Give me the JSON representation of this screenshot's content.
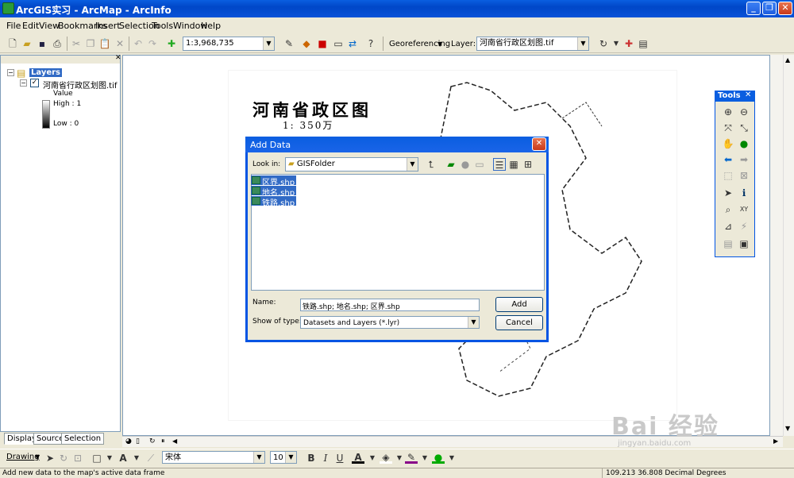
{
  "window": {
    "title": "ArcGIS实习 - ArcMap - ArcInfo",
    "minimize_glyph": "_",
    "maximize_glyph": "❐",
    "close_glyph": "✕"
  },
  "menu": [
    "File",
    "Edit",
    "View",
    "Bookmarks",
    "Insert",
    "Selection",
    "Tools",
    "Window",
    "Help"
  ],
  "standard_toolbar": {
    "scale": "1:3,968,735"
  },
  "georef_toolbar": {
    "georeferencing_label": "Georeferencing",
    "layer_label": "Layer:",
    "layer_value": "河南省行政区划图.tif"
  },
  "toc": {
    "root": "Layers",
    "layer_name": "河南省行政区划图.tif",
    "value_label": "Value",
    "high": "High : 1",
    "low": "Low : 0",
    "tabs": [
      "Display",
      "Source",
      "Selection"
    ]
  },
  "map": {
    "title": "河南省政区图",
    "scale": "1: 350万"
  },
  "dialog": {
    "title": "Add Data",
    "look_in_label": "Look in:",
    "look_in_value": "GISFolder",
    "files": [
      "区界.shp",
      "地名.shp",
      "铁路.shp"
    ],
    "name_label": "Name:",
    "name_value": "铁路.shp; 地名.shp; 区界.shp",
    "type_label": "Show of type:",
    "type_value": "Datasets and Layers (*.lyr)",
    "add_label": "Add",
    "cancel_label": "Cancel"
  },
  "tools_window": {
    "title": "Tools"
  },
  "drawing_toolbar": {
    "drawing_label": "Drawing",
    "font_name": "宋体",
    "font_size": "10",
    "bold": "B",
    "italic": "I",
    "underline": "U",
    "text_tool": "A"
  },
  "status": {
    "message": "Add new data to the map's active data frame",
    "coords": "109.213  36.808 Decimal Degrees"
  },
  "watermark": {
    "text": "Bai 经验",
    "url": "jingyan.baidu.com"
  },
  "colors": {
    "xp_blue": "#0054e3",
    "selection": "#316ac5",
    "panel": "#ece9d8"
  }
}
